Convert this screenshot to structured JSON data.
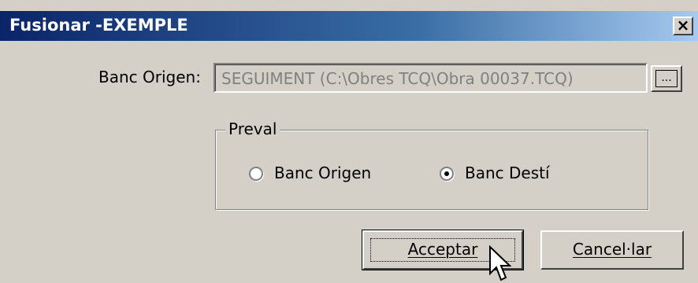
{
  "window": {
    "title": "Fusionar -EXEMPLE",
    "close_label": "×"
  },
  "origin": {
    "label": "Banc Origen:",
    "value": "SEGUIMENT (C:\\Obres TCQ\\Obra 00037.TCQ)",
    "browse_label": "..."
  },
  "preval": {
    "legend": "Preval",
    "options": [
      {
        "label": "Banc Origen",
        "selected": false
      },
      {
        "label": "Banc Destí",
        "selected": true
      }
    ]
  },
  "buttons": {
    "accept_label": "Acceptar",
    "cancel_label": "Cancel·lar"
  },
  "colors": {
    "title_gradient_start": "#0a246a",
    "title_gradient_end": "#a6caf0",
    "face": "#d4d0c8"
  }
}
